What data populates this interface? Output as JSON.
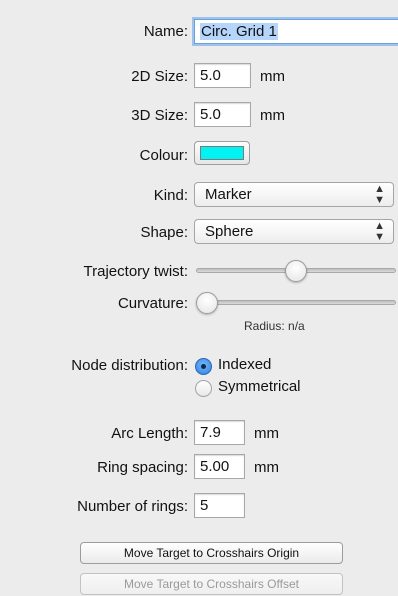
{
  "form": {
    "name_label": "Name:",
    "name_value": "Circ. Grid 1",
    "size2d_label": "2D Size:",
    "size2d_value": "5.0",
    "size2d_unit": "mm",
    "size3d_label": "3D Size:",
    "size3d_value": "5.0",
    "size3d_unit": "mm",
    "colour_label": "Colour:",
    "colour_value": "#00f2f2",
    "kind_label": "Kind:",
    "kind_value": "Marker",
    "shape_label": "Shape:",
    "shape_value": "Sphere",
    "twist_label": "Trajectory twist:",
    "twist_level": 0.5,
    "curvature_label": "Curvature:",
    "curvature_level": 0.0,
    "radius_text": "Radius:  n/a",
    "node_label": "Node distribution:",
    "node_options": [
      "Indexed",
      "Symmetrical"
    ],
    "node_selected": "Indexed",
    "arc_label": "Arc Length:",
    "arc_value": "7.9",
    "arc_unit": "mm",
    "ring_label": "Ring spacing:",
    "ring_value": "5.00",
    "ring_unit": "mm",
    "rings_label": "Number of rings:",
    "rings_value": "5"
  },
  "buttons": {
    "move_origin": "Move Target to Crosshairs Origin",
    "move_offset": "Move Target to Crosshairs Offset"
  }
}
